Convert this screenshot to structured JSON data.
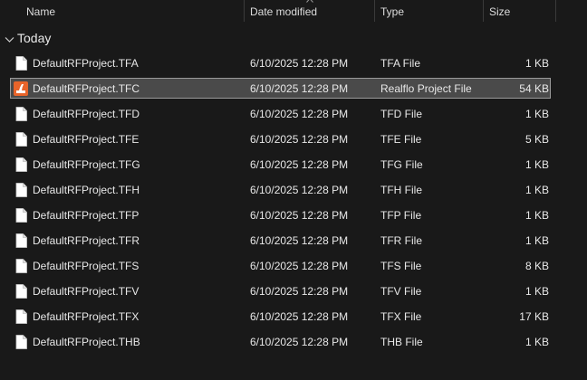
{
  "columns": {
    "name": "Name",
    "date": "Date modified",
    "type": "Type",
    "size": "Size"
  },
  "group": {
    "label": "Today"
  },
  "files": [
    {
      "name": "DefaultRFProject.TFA",
      "date": "6/10/2025 12:28 PM",
      "type": "TFA File",
      "size": "1 KB",
      "icon": "blank-file-icon",
      "selected": false
    },
    {
      "name": "DefaultRFProject.TFC",
      "date": "6/10/2025 12:28 PM",
      "type": "Realflo Project File",
      "size": "54 KB",
      "icon": "realflo-file-icon",
      "selected": true
    },
    {
      "name": "DefaultRFProject.TFD",
      "date": "6/10/2025 12:28 PM",
      "type": "TFD File",
      "size": "1 KB",
      "icon": "blank-file-icon",
      "selected": false
    },
    {
      "name": "DefaultRFProject.TFE",
      "date": "6/10/2025 12:28 PM",
      "type": "TFE File",
      "size": "5 KB",
      "icon": "blank-file-icon",
      "selected": false
    },
    {
      "name": "DefaultRFProject.TFG",
      "date": "6/10/2025 12:28 PM",
      "type": "TFG File",
      "size": "1 KB",
      "icon": "blank-file-icon",
      "selected": false
    },
    {
      "name": "DefaultRFProject.TFH",
      "date": "6/10/2025 12:28 PM",
      "type": "TFH File",
      "size": "1 KB",
      "icon": "blank-file-icon",
      "selected": false
    },
    {
      "name": "DefaultRFProject.TFP",
      "date": "6/10/2025 12:28 PM",
      "type": "TFP File",
      "size": "1 KB",
      "icon": "blank-file-icon",
      "selected": false
    },
    {
      "name": "DefaultRFProject.TFR",
      "date": "6/10/2025 12:28 PM",
      "type": "TFR File",
      "size": "1 KB",
      "icon": "blank-file-icon",
      "selected": false
    },
    {
      "name": "DefaultRFProject.TFS",
      "date": "6/10/2025 12:28 PM",
      "type": "TFS File",
      "size": "8 KB",
      "icon": "blank-file-icon",
      "selected": false
    },
    {
      "name": "DefaultRFProject.TFV",
      "date": "6/10/2025 12:28 PM",
      "type": "TFV File",
      "size": "1 KB",
      "icon": "blank-file-icon",
      "selected": false
    },
    {
      "name": "DefaultRFProject.TFX",
      "date": "6/10/2025 12:28 PM",
      "type": "TFX File",
      "size": "17 KB",
      "icon": "blank-file-icon",
      "selected": false
    },
    {
      "name": "DefaultRFProject.THB",
      "date": "6/10/2025 12:28 PM",
      "type": "THB File",
      "size": "1 KB",
      "icon": "blank-file-icon",
      "selected": false
    }
  ],
  "colors": {
    "background": "#191919",
    "selection": "#4a4a4a",
    "selection_border": "#9a9a9a",
    "text": "#e8e8e8",
    "realflo_accent": "#e8642a"
  }
}
